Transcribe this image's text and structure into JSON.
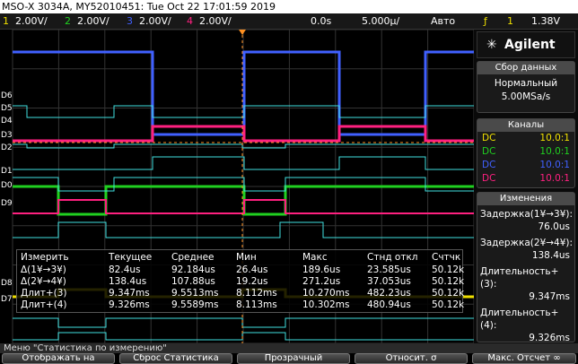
{
  "title": "MSO-X 3034A, MY52010451: Tue Oct 22 17:01:59 2019",
  "channels": {
    "c1": "1",
    "v1": "2.00V/",
    "c2": "2",
    "v2": "2.00V/",
    "c3": "3",
    "v3": "2.00V/",
    "c4": "4",
    "v4": "2.00V/",
    "delay": "0.0s",
    "timebase": "5.000µ/",
    "mode": "Авто",
    "trig_icon": "ƒ",
    "trig_ch": "1",
    "trig_level": "1.38V"
  },
  "colors": {
    "ch1": "#f0e000",
    "ch2": "#20d020",
    "ch3": "#4060ff",
    "ch4": "#ff2080",
    "digital": "#40e0e0",
    "orange": "#ff9020"
  },
  "brand": "Agilent",
  "acq": {
    "head": "Сбор данных",
    "mode": "Нормальный",
    "rate": "5.00MSa/s"
  },
  "chan": {
    "head": "Каналы",
    "rows": [
      {
        "c": "DC",
        "v": "10.0:1"
      },
      {
        "c": "DC",
        "v": "10.0:1"
      },
      {
        "c": "DC",
        "v": "10.0:1"
      },
      {
        "c": "DC",
        "v": "10.0:1"
      }
    ]
  },
  "changes": {
    "head": "Изменения",
    "items": [
      {
        "label": "Задержка(1¥→3¥):",
        "value": "76.0us"
      },
      {
        "label": "Задержка(2¥→4¥):",
        "value": "138.4us"
      },
      {
        "label": "Длительность+(3):",
        "value": "9.347ms"
      },
      {
        "label": "Длительность+(4):",
        "value": "9.326ms"
      }
    ]
  },
  "meas": {
    "headers": [
      "Измерить",
      "Текущее",
      "Среднее",
      "Мин",
      "Макс",
      "Стнд откл",
      "Счтчк"
    ],
    "rows": [
      [
        "Δ(1¥→3¥)",
        "82.4us",
        "92.184us",
        "26.4us",
        "189.6us",
        "23.585us",
        "50.12k"
      ],
      [
        "Δ(2¥→4¥)",
        "138.4us",
        "107.88us",
        "19.2us",
        "271.2us",
        "37.053us",
        "50.12k"
      ],
      [
        "Длит+(3)",
        "9.347ms",
        "9.5513ms",
        "8.112ms",
        "10.270ms",
        "482.23us",
        "50.12k"
      ],
      [
        "Длит+(4)",
        "9.326ms",
        "9.5589ms",
        "8.113ms",
        "10.302ms",
        "480.94us",
        "50.12k"
      ]
    ]
  },
  "menu": {
    "title": "Меню \"Статистика по измерению\"",
    "keys": [
      "Отображать на",
      "Сброс Статистика",
      "Прозрачный",
      "Относит. σ",
      "Макс. Отсчет ∞"
    ]
  },
  "digital_labels": [
    "D6",
    "D5",
    "D4",
    "D3",
    "D2",
    "D1",
    "D0",
    "D9",
    "D8",
    "D7"
  ]
}
